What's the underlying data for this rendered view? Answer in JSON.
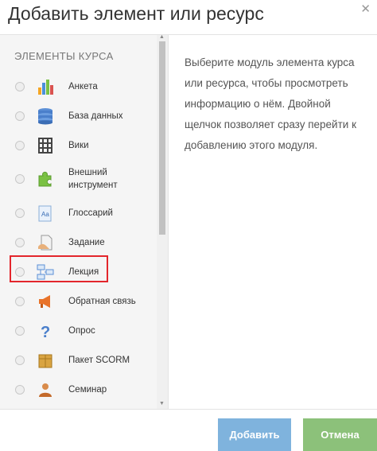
{
  "dialog": {
    "title": "Добавить элемент или ресурс",
    "close_icon": "close-icon"
  },
  "section_title": "ЭЛЕМЕНТЫ КУРСА",
  "items": [
    {
      "label": "Анкета",
      "icon": "chart-icon"
    },
    {
      "label": "База данных",
      "icon": "database-icon"
    },
    {
      "label": "Вики",
      "icon": "wiki-icon"
    },
    {
      "label": "Внешний инструмент",
      "icon": "puzzle-icon"
    },
    {
      "label": "Глоссарий",
      "icon": "glossary-icon"
    },
    {
      "label": "Задание",
      "icon": "assignment-icon"
    },
    {
      "label": "Лекция",
      "icon": "lesson-icon"
    },
    {
      "label": "Обратная связь",
      "icon": "megaphone-icon"
    },
    {
      "label": "Опрос",
      "icon": "question-icon"
    },
    {
      "label": "Пакет SCORM",
      "icon": "scorm-box-icon"
    },
    {
      "label": "Семинар",
      "icon": "workshop-icon"
    }
  ],
  "description": "Выберите модуль элемента курса или ресурса, чтобы просмотреть информацию о нём. Двойной щелчок позволяет сразу перейти к добавлению этого модуля.",
  "buttons": {
    "add": "Добавить",
    "cancel": "Отмена"
  },
  "colors": {
    "add_button": "#7fb3dd",
    "cancel_button": "#8cc17a",
    "highlight": "#e3262c"
  }
}
